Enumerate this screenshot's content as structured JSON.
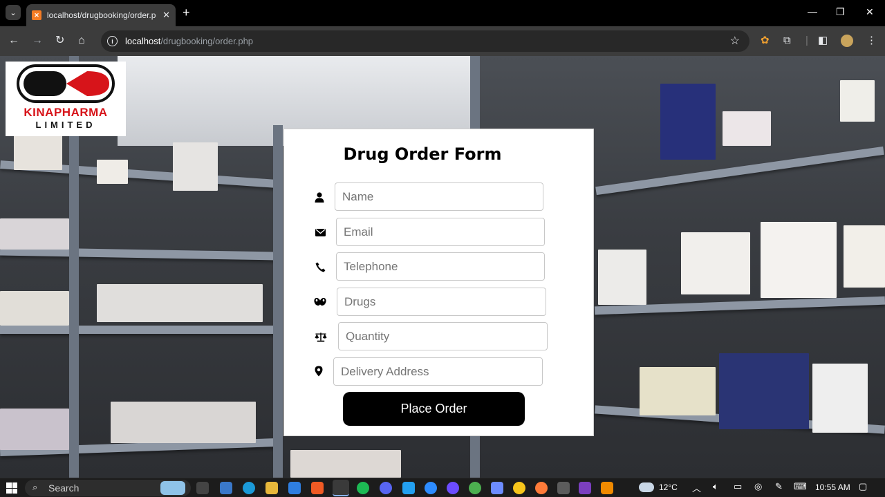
{
  "browser": {
    "tab_title": "localhost/drugbooking/order.p",
    "url_host": "localhost",
    "url_path": "/drugbooking/order.php"
  },
  "logo": {
    "line1": "KINAPHARMA",
    "line2": "LIMITED"
  },
  "form": {
    "title": "Drug Order Form",
    "fields": [
      {
        "icon": "user-icon",
        "placeholder": "Name"
      },
      {
        "icon": "envelope-icon",
        "placeholder": "Email"
      },
      {
        "icon": "phone-icon",
        "placeholder": "Telephone"
      },
      {
        "icon": "pills-icon",
        "placeholder": "Drugs"
      },
      {
        "icon": "scale-icon",
        "placeholder": "Quantity"
      },
      {
        "icon": "map-marker-icon",
        "placeholder": "Delivery Address"
      }
    ],
    "submit_label": "Place Order"
  },
  "taskbar": {
    "search_label": "Search",
    "weather": "12°C",
    "time": "10:55 AM"
  },
  "colors": {
    "accent_black": "#000000",
    "brand_red": "#d7141a"
  }
}
